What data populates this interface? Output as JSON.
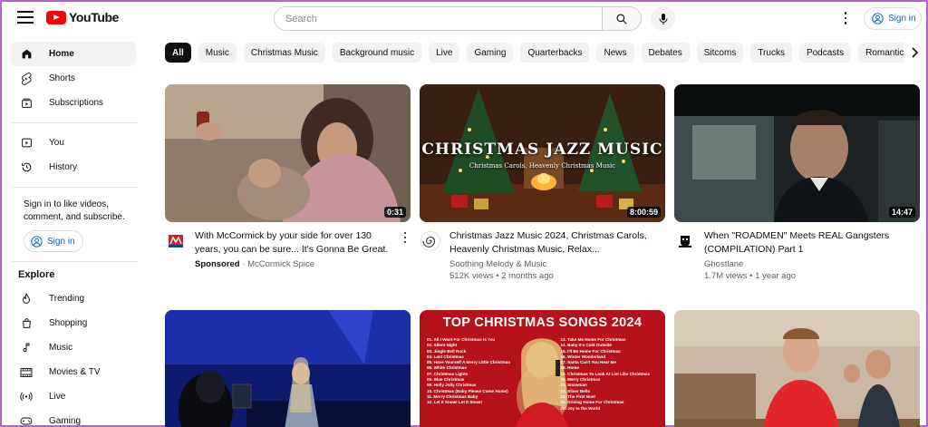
{
  "header": {
    "logo_text": "YouTube",
    "search_placeholder": "Search",
    "signin_label": "Sign in"
  },
  "sidebar": {
    "main": [
      {
        "label": "Home",
        "icon": "home-icon",
        "active": true
      },
      {
        "label": "Shorts",
        "icon": "shorts-icon"
      },
      {
        "label": "Subscriptions",
        "icon": "subscriptions-icon"
      }
    ],
    "you": [
      {
        "label": "You",
        "icon": "you-icon"
      },
      {
        "label": "History",
        "icon": "history-icon"
      }
    ],
    "signin_note": "Sign in to like videos, comment, and subscribe.",
    "signin_label": "Sign in",
    "explore_title": "Explore",
    "explore": [
      {
        "label": "Trending",
        "icon": "trending-icon"
      },
      {
        "label": "Shopping",
        "icon": "shopping-icon"
      },
      {
        "label": "Music",
        "icon": "music-icon"
      },
      {
        "label": "Movies & TV",
        "icon": "movies-icon"
      },
      {
        "label": "Live",
        "icon": "live-icon"
      },
      {
        "label": "Gaming",
        "icon": "gaming-icon"
      }
    ]
  },
  "chips": [
    "All",
    "Music",
    "Christmas Music",
    "Background music",
    "Live",
    "Gaming",
    "Quarterbacks",
    "News",
    "Debates",
    "Sitcoms",
    "Trucks",
    "Podcasts",
    "Romantic c"
  ],
  "videos": [
    {
      "title": "With McCormick by your side for over 130 years, you can be sure... It's Gonna Be Great.",
      "sponsored": "Sponsored",
      "channel": "McCormick Spice",
      "duration": "0:31",
      "views": "",
      "age": ""
    },
    {
      "title": "Christmas Jazz Music 2024, Christmas Carols, Heavenly Christmas Music, Relax...",
      "channel": "Soothing Melody & Music",
      "views": "512K views",
      "age": "2 months ago",
      "duration": "8:00:59",
      "thumb_title": "CHRISTMAS JAZZ MUSIC",
      "thumb_sub": "Christmas Carols, Heavenly Christmas Music"
    },
    {
      "title": "When \"ROADMEN\" Meets REAL Gangsters (COMPILATION) Part 1",
      "channel": "Ghostlane",
      "views": "1.7M views",
      "age": "1 year ago",
      "duration": "14:47"
    },
    {
      "title": "",
      "channel": "",
      "duration": ""
    },
    {
      "title": "",
      "channel": "",
      "duration": "",
      "thumb_title": "TOP CHRISTMAS SONGS 2024",
      "songs_left": [
        "01. All I Want For Christmas Is You",
        "02. Silent Night",
        "03. Jingle Bell Rock",
        "04. Last Christmas",
        "05. Have Yourself A Merry Little Christmas",
        "06. White Christmas",
        "07. Christmas Lights",
        "08. Blue Christmas",
        "09. Holly Jolly Christmas",
        "10. Christmas (Baby Please Come Home)",
        "11. Merry Christmas Baby",
        "12. Let It Snow! Let It Snow!"
      ],
      "songs_right": [
        "13. Take Me Home For Christmas",
        "14. Baby It's Cold Outside",
        "15. I'll Be Home For Christmas",
        "16. Winter Wonderland",
        "17. Santa Can't You Hear Me",
        "18. Home",
        "19. Christmas To Look At List Like Christmas",
        "20. Merry Christmas",
        "21. Snowman",
        "22. Silver Bells",
        "23. The First Noel",
        "24. Driving Home For Christmas",
        "25. Joy to the World"
      ]
    },
    {
      "title": "",
      "channel": "",
      "duration": ""
    }
  ],
  "colors": {
    "brand_red": "#ff0000",
    "link_blue": "#065fd4",
    "chip_bg": "#f2f2f2",
    "chip_active": "#0f0f0f"
  }
}
